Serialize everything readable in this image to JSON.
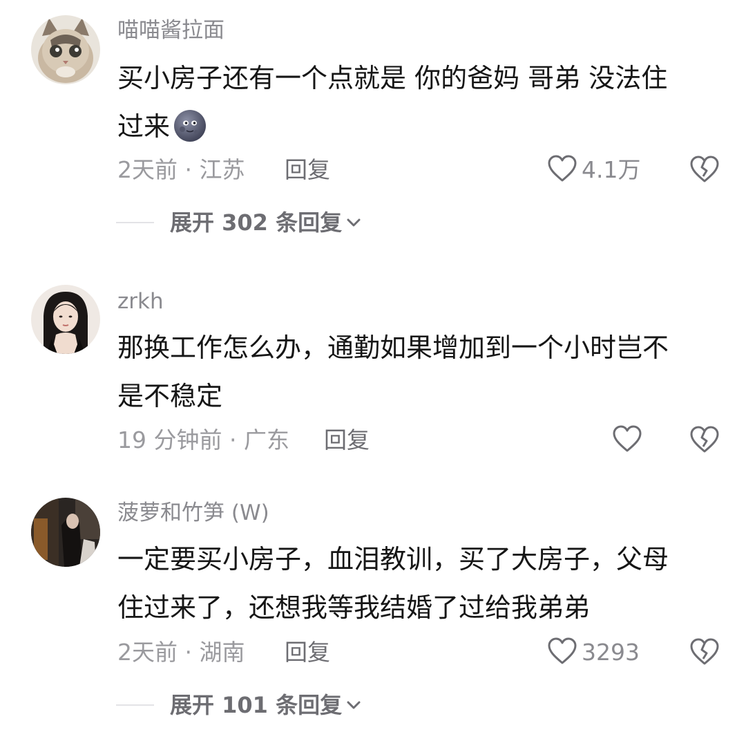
{
  "comments": [
    {
      "username": "喵喵酱拉面",
      "text": "买小房子还有一个点就是 你的爸妈 哥弟 没法住\n过来",
      "emoji": "new-moon-face-emoji",
      "time": "2天前 · 江苏",
      "reply_label": "回复",
      "likes": "4.1万",
      "expand_label": "展开 302 条回复"
    },
    {
      "username": "zrkh",
      "text": "那换工作怎么办，通勤如果增加到一个小时岂不\n是不稳定",
      "time": "19 分钟前 · 广东",
      "reply_label": "回复",
      "likes": ""
    },
    {
      "username": "菠萝和竹笋 (W)",
      "text": "一定要买小房子，血泪教训，买了大房子，父母\n住过来了，还想我等我结婚了过给我弟弟",
      "time": "2天前 · 湖南",
      "reply_label": "回复",
      "likes": "3293",
      "expand_label": "展开 101 条回复"
    }
  ],
  "icons": {
    "like": "heart-outline-icon",
    "dislike": "broken-heart-icon",
    "expand": "chevron-down-icon"
  },
  "colors": {
    "text_primary": "#161616",
    "text_secondary": "#8a8a8f",
    "icon_stroke": "#6d6d72"
  }
}
